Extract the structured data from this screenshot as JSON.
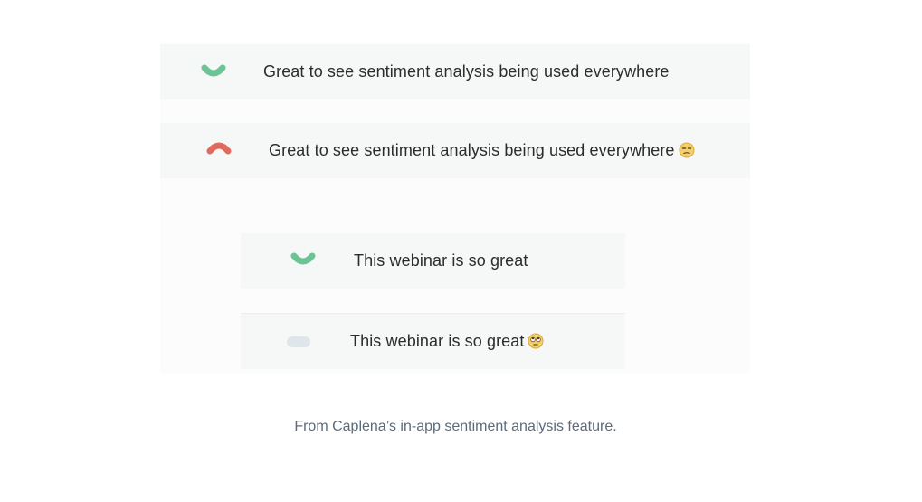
{
  "figure": {
    "rows": [
      {
        "text": "Great to see sentiment analysis being used everywhere",
        "sentiment": "positive",
        "icon": "smile-arc-icon",
        "emoji": ""
      },
      {
        "text": "Great to see sentiment analysis being used everywhere",
        "sentiment": "negative",
        "icon": "frown-arc-icon",
        "emoji": "unamused-face-emoji"
      },
      {
        "text": "This webinar is so great",
        "sentiment": "positive",
        "icon": "smile-arc-icon",
        "emoji": ""
      },
      {
        "text": "This webinar is so great",
        "sentiment": "neutral",
        "icon": "neutral-pill-icon",
        "emoji": "rolling-eyes-emoji"
      }
    ]
  },
  "colors": {
    "positive": "#6cc495",
    "negative": "#e06a5d",
    "neutral": "#dfe6eb",
    "row_bg": "#f6f7f7",
    "caption": "#5c6b7a"
  },
  "caption": "From Caplena’s in-app sentiment analysis feature."
}
